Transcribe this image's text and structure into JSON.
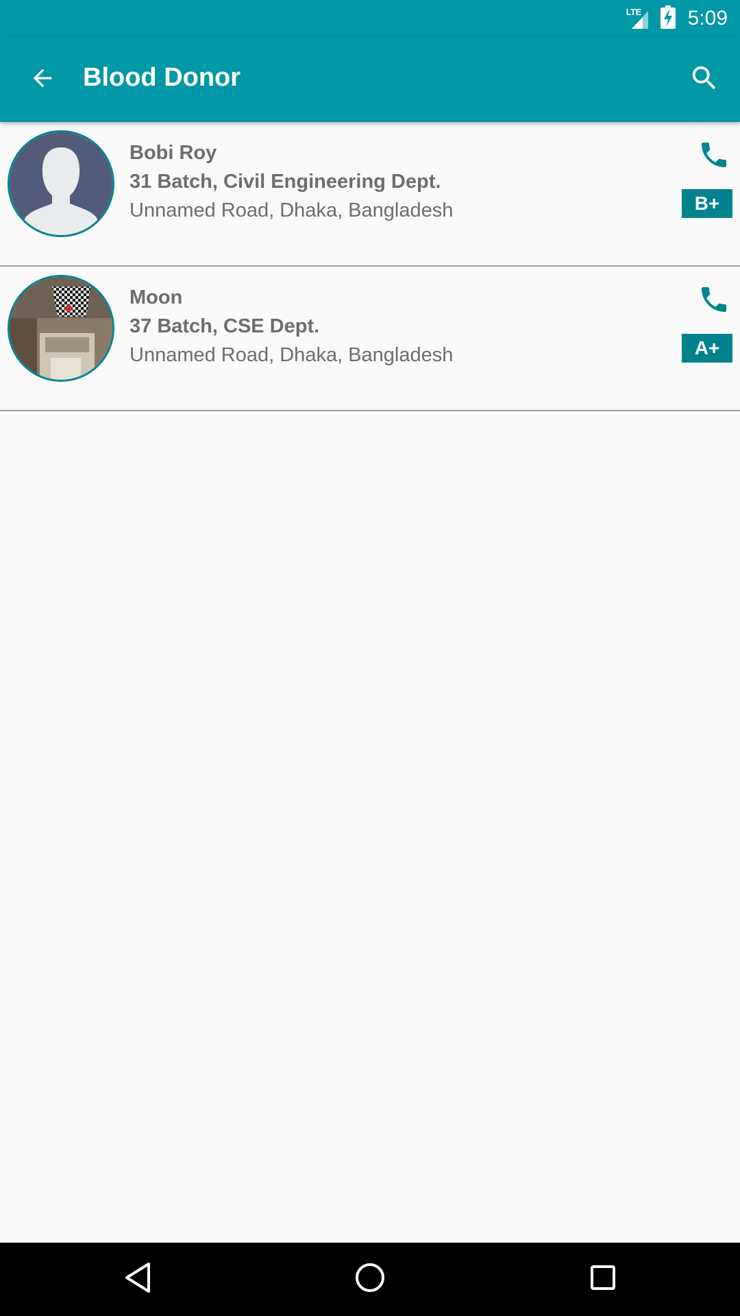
{
  "status_bar": {
    "network_label": "LTE",
    "time": "5:09",
    "icons": [
      "lte-signal-icon",
      "battery-charging-icon"
    ]
  },
  "app_bar": {
    "title": "Blood Donor",
    "icons": [
      "back-arrow-icon",
      "search-icon"
    ]
  },
  "donors": [
    {
      "name": "Bobi Roy",
      "batch_dept": "31 Batch, Civil Engineering Dept.",
      "address": "Unnamed Road, Dhaka, Bangladesh",
      "blood_group": "B+",
      "avatar": "default-person-avatar",
      "action_icon": "phone-icon"
    },
    {
      "name": "Moon",
      "batch_dept": "37 Batch, CSE Dept.",
      "address": "Unnamed Road, Dhaka, Bangladesh",
      "blood_group": "A+",
      "avatar": "room-photo-avatar",
      "action_icon": "phone-icon"
    }
  ],
  "nav_bar": {
    "icons": [
      "back-triangle-icon",
      "home-circle-icon",
      "recents-square-icon"
    ]
  },
  "colors": {
    "primary": "#0097a7",
    "accent": "#00838f",
    "text": "#6d6d6d",
    "background": "#fafafa"
  }
}
